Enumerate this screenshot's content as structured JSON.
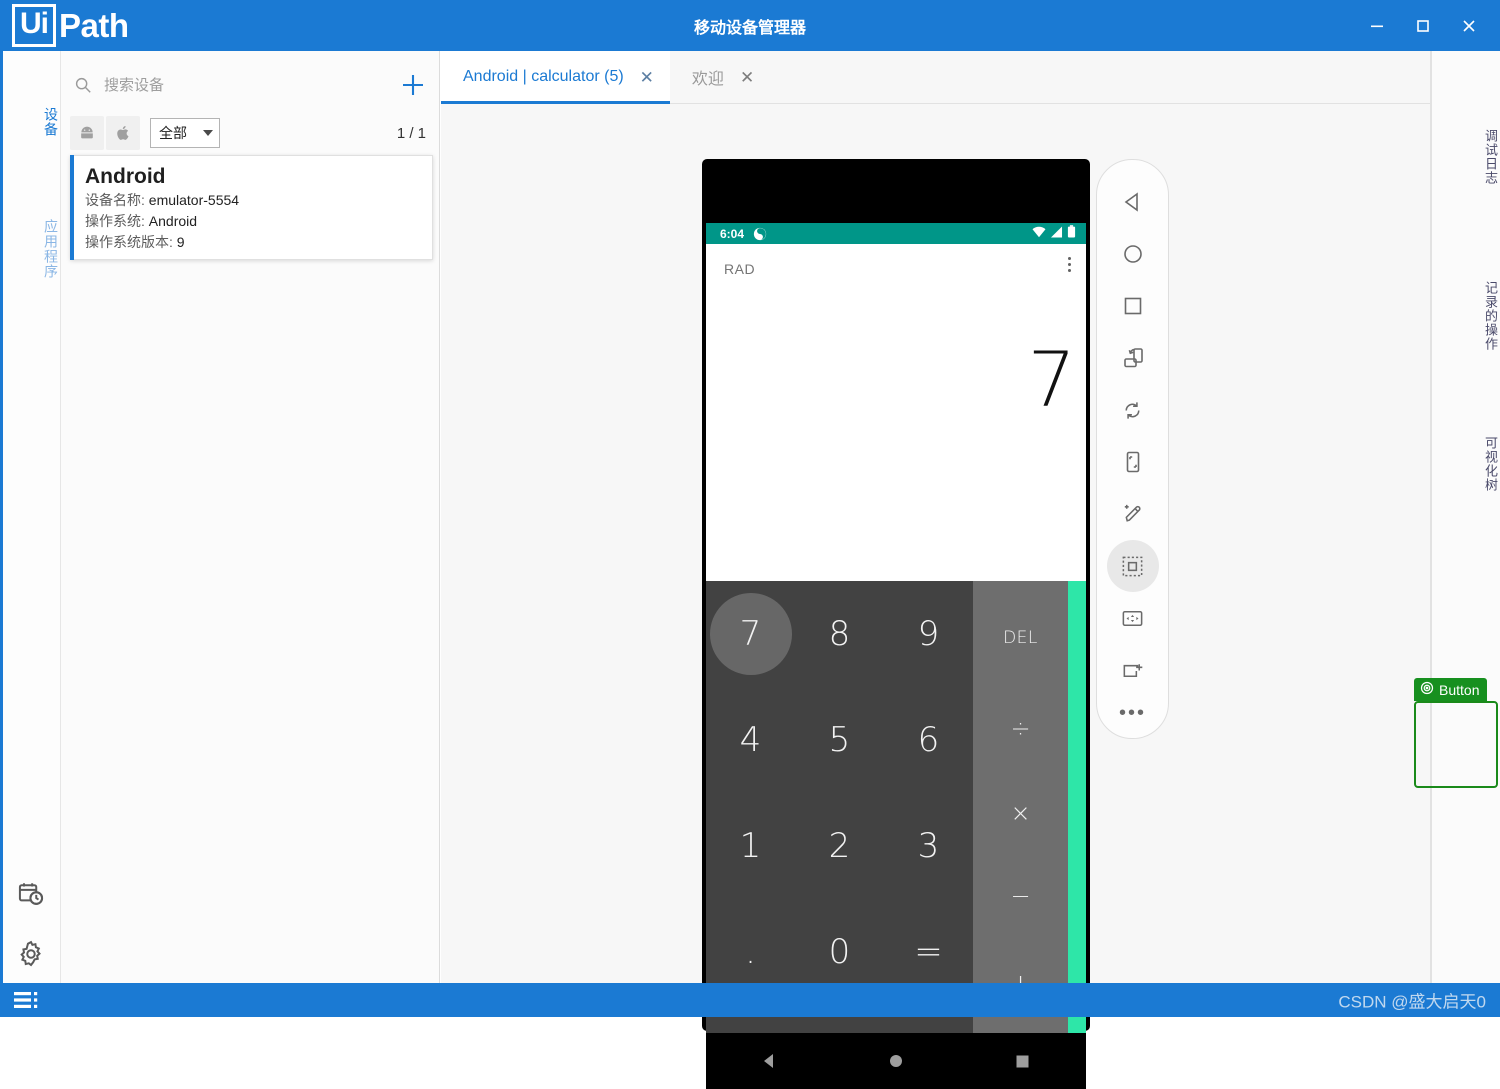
{
  "window": {
    "brand_ui": "Ui",
    "brand_path": "Path",
    "title": "移动设备管理器",
    "controls": [
      {
        "name": "minimize",
        "label": "—"
      },
      {
        "name": "maximize",
        "label": "□"
      },
      {
        "name": "close",
        "label": "✕"
      }
    ],
    "accent_color": "#1b7ad3"
  },
  "left_rail": {
    "items": [
      {
        "label": "设备",
        "active": true
      },
      {
        "label": "应用程序",
        "active": false
      }
    ],
    "bottom_icons": [
      {
        "name": "schedule-icon"
      },
      {
        "name": "settings-icon"
      }
    ]
  },
  "device_panel": {
    "search": {
      "placeholder": "搜索设备",
      "value": ""
    },
    "add_label": "+",
    "platform_filters": [
      {
        "name": "android-filter",
        "label": "Android"
      },
      {
        "name": "ios-filter",
        "label": "iOS"
      }
    ],
    "select": {
      "value": "全部"
    },
    "pager": "1 / 1",
    "cards": [
      {
        "title": "Android",
        "rows": [
          {
            "key": "设备名称:",
            "value": "emulator-5554"
          },
          {
            "key": "操作系统:",
            "value": "Android"
          },
          {
            "key": "操作系统版本:",
            "value": "9"
          }
        ]
      }
    ]
  },
  "tabs": [
    {
      "label": "Android | calculator (5)",
      "close": "✕",
      "active": true
    },
    {
      "label": "欢迎",
      "close": "✕",
      "active": false
    }
  ],
  "phone": {
    "status_bar": {
      "time": "6:04",
      "app_icon": "sync-icon",
      "wifi_icon": "wifi-icon",
      "signal_icon": "signal-icon",
      "battery_icon": "battery-icon",
      "color": "#009688"
    },
    "calculator": {
      "mode_label": "RAD",
      "overflow_menu": "⋮",
      "display_value": "7",
      "number_keys": [
        {
          "label": "7",
          "pressed": true
        },
        {
          "label": "8",
          "pressed": false
        },
        {
          "label": "9",
          "pressed": false
        },
        {
          "label": "4",
          "pressed": false
        },
        {
          "label": "5",
          "pressed": false
        },
        {
          "label": "6",
          "pressed": false
        },
        {
          "label": "1",
          "pressed": false
        },
        {
          "label": "2",
          "pressed": false
        },
        {
          "label": "3",
          "pressed": false
        },
        {
          "label": ".",
          "pressed": false
        },
        {
          "label": "0",
          "pressed": false
        },
        {
          "label": "=",
          "pressed": false
        }
      ],
      "operator_keys": [
        {
          "label": "DEL"
        },
        {
          "label": "÷"
        },
        {
          "label": "×"
        },
        {
          "label": "−"
        },
        {
          "label": "+"
        }
      ],
      "accent_edge_color": "#2ee6a8"
    },
    "selection": {
      "tag_label": "Button",
      "tag_icon": "target-icon",
      "tag_color": "#17901f"
    },
    "nav_bar": [
      {
        "name": "back-icon"
      },
      {
        "name": "home-icon"
      },
      {
        "name": "recents-icon"
      }
    ]
  },
  "vertical_toolbar": {
    "items": [
      {
        "name": "back-nav-icon",
        "active": false
      },
      {
        "name": "home-nav-icon",
        "active": false
      },
      {
        "name": "recents-nav-icon",
        "active": false
      },
      {
        "name": "rotate-device-icon",
        "active": false
      },
      {
        "name": "refresh-icon",
        "active": false
      },
      {
        "name": "screenshot-icon",
        "active": false
      },
      {
        "name": "edit-text-icon",
        "active": false
      },
      {
        "name": "select-element-icon",
        "active": true
      },
      {
        "name": "swipe-icon",
        "active": false
      },
      {
        "name": "add-region-icon",
        "active": false
      }
    ],
    "more_label": "•••"
  },
  "right_rail": {
    "items": [
      {
        "label": "调试日志"
      },
      {
        "label": "记录的操作"
      },
      {
        "label": "可视化树"
      }
    ]
  },
  "status_bar": {
    "menu_icon": "list-menu-icon",
    "watermark": "CSDN @盛大启天0"
  }
}
